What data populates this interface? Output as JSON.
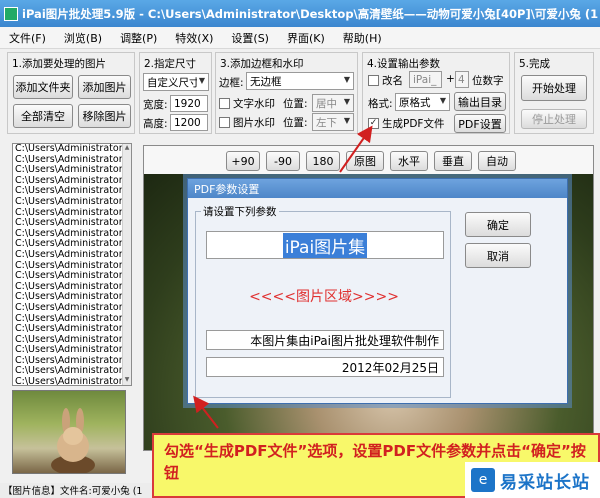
{
  "window": {
    "title": "iPai图片批处理5.9版 - C:\\Users\\Administrator\\Desktop\\高清壁纸——动物可爱小兔[40P]\\可爱小兔 (1"
  },
  "menu": [
    {
      "label": "文件(F)"
    },
    {
      "label": "浏览(B)"
    },
    {
      "label": "调整(P)"
    },
    {
      "label": "特效(X)"
    },
    {
      "label": "设置(S)"
    },
    {
      "label": "界面(K)"
    },
    {
      "label": "帮助(H)"
    }
  ],
  "panel1": {
    "label": "1.添加要处理的图片",
    "add_folder": "添加文件夹",
    "add_image": "添加图片",
    "clear_all": "全部清空",
    "remove_image": "移除图片"
  },
  "panel2": {
    "label": "2.指定尺寸",
    "size_mode": "自定义尺寸",
    "width_label": "宽度:",
    "width_value": "1920",
    "height_label": "高度:",
    "height_value": "1200"
  },
  "panel3": {
    "label": "3.添加边框和水印",
    "border_label": "边框:",
    "border_value": "无边框",
    "text_watermark": "文字水印",
    "image_watermark": "图片水印",
    "position_label": "位置:",
    "position1": "居中",
    "position2": "左下"
  },
  "panel4": {
    "label": "4.设置输出参数",
    "rename_label": "改名",
    "rename_value": "iPai_",
    "plus": "+",
    "digits_value": "4",
    "digits_label": "位数字",
    "format_label": "格式:",
    "format_value": "原格式",
    "output_dir": "输出目录",
    "gen_pdf": "生成PDF文件",
    "pdf_settings": "PDF设置"
  },
  "panel5": {
    "label": "5.完成",
    "start": "开始处理",
    "stop": "停止处理"
  },
  "files": [
    "C:\\Users\\Administrator\\D",
    "C:\\Users\\Administrator\\D",
    "C:\\Users\\Administrator\\D",
    "C:\\Users\\Administrator\\D",
    "C:\\Users\\Administrator\\D",
    "C:\\Users\\Administrator\\D",
    "C:\\Users\\Administrator\\D",
    "C:\\Users\\Administrator\\D",
    "C:\\Users\\Administrator\\D",
    "C:\\Users\\Administrator\\D",
    "C:\\Users\\Administrator\\D",
    "C:\\Users\\Administrator\\D",
    "C:\\Users\\Administrator\\D",
    "C:\\Users\\Administrator\\D",
    "C:\\Users\\Administrator\\D",
    "C:\\Users\\Administrator\\D",
    "C:\\Users\\Administrator\\D",
    "C:\\Users\\Administrator\\D",
    "C:\\Users\\Administrator\\D",
    "C:\\Users\\Administrator\\D",
    "C:\\Users\\Administrator\\D",
    "C:\\Users\\Administrator\\D",
    "C:\\Users\\Administrator\\D"
  ],
  "toolbar": [
    {
      "label": "+90"
    },
    {
      "label": "-90"
    },
    {
      "label": "180"
    },
    {
      "label": "原图"
    },
    {
      "label": "水平"
    },
    {
      "label": "垂直"
    },
    {
      "label": "自动"
    }
  ],
  "dialog": {
    "title": "PDF参数设置",
    "group_label": "请设置下列参数",
    "pdf_title": "iPai图片集",
    "image_area": "<<<<图片区域>>>>",
    "description": "本图片集由iPai图片批处理软件制作",
    "date": "2012年02月25日",
    "ok": "确定",
    "cancel": "取消"
  },
  "statusbar": {
    "text": "【图片信息】文件名:可爱小兔 (1"
  },
  "callout": {
    "text": "勾选“生成PDF文件”选项，设置PDF文件参数并点击“确定”按钮"
  },
  "watermark": {
    "text": "易采站长站",
    "logo": "e"
  },
  "colors": {
    "title_blue": "#3b86cf",
    "callout_red": "#d12020",
    "callout_bg": "#f8f86a",
    "pdf_title_highlight": "#3b7fd8"
  }
}
